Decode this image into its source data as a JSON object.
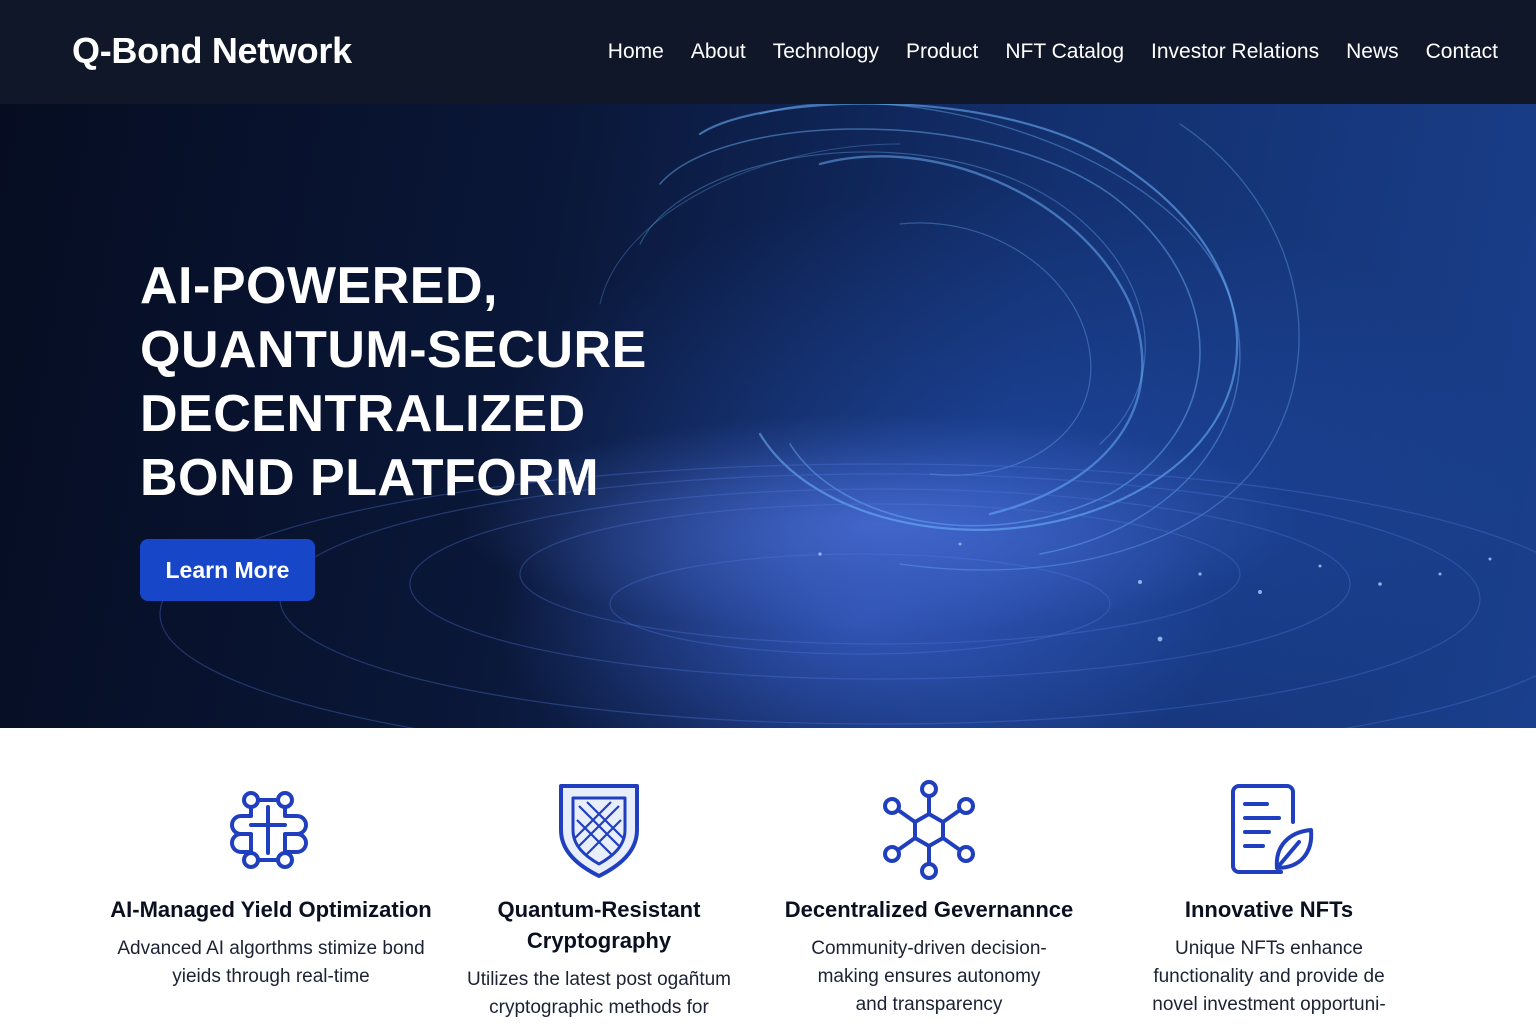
{
  "brand": {
    "name": "Q-Bond Network"
  },
  "nav": {
    "items": [
      {
        "label": "Home"
      },
      {
        "label": "About"
      },
      {
        "label": "Technology"
      },
      {
        "label": "Product"
      },
      {
        "label": "NFT Catalog"
      },
      {
        "label": "Investor Relations"
      },
      {
        "label": "News"
      },
      {
        "label": "Contact"
      }
    ]
  },
  "hero": {
    "title_lines": [
      "AI-POWERED,",
      "QUANTUM-SECURE",
      "DECENTRALIZED",
      "BOND PLATFORM"
    ],
    "cta_label": "Learn More"
  },
  "features": [
    {
      "icon": "ai-circuit-icon",
      "title": "AI-Managed Yield Optimization",
      "text": "Advanced AI algorthms stimize bond yieids through real-time"
    },
    {
      "icon": "shield-lattice-icon",
      "title": "Quantum-Resistant Cryptography",
      "text": "Utilizes the latest post ogañtum cryptographic methods for"
    },
    {
      "icon": "network-hexagon-icon",
      "title": "Decentralized Gevernannce",
      "text": "Community-driven decision-making ensures autonomy and transparency"
    },
    {
      "icon": "document-leaf-icon",
      "title": "Innovative NFTs",
      "text": "Unique NFTs enhance functionality and provide de novel investment opportuni-"
    }
  ],
  "colors": {
    "nav_bg": "#0f1729",
    "accent": "#1746c9",
    "icon_blue": "#1f3fbf"
  }
}
